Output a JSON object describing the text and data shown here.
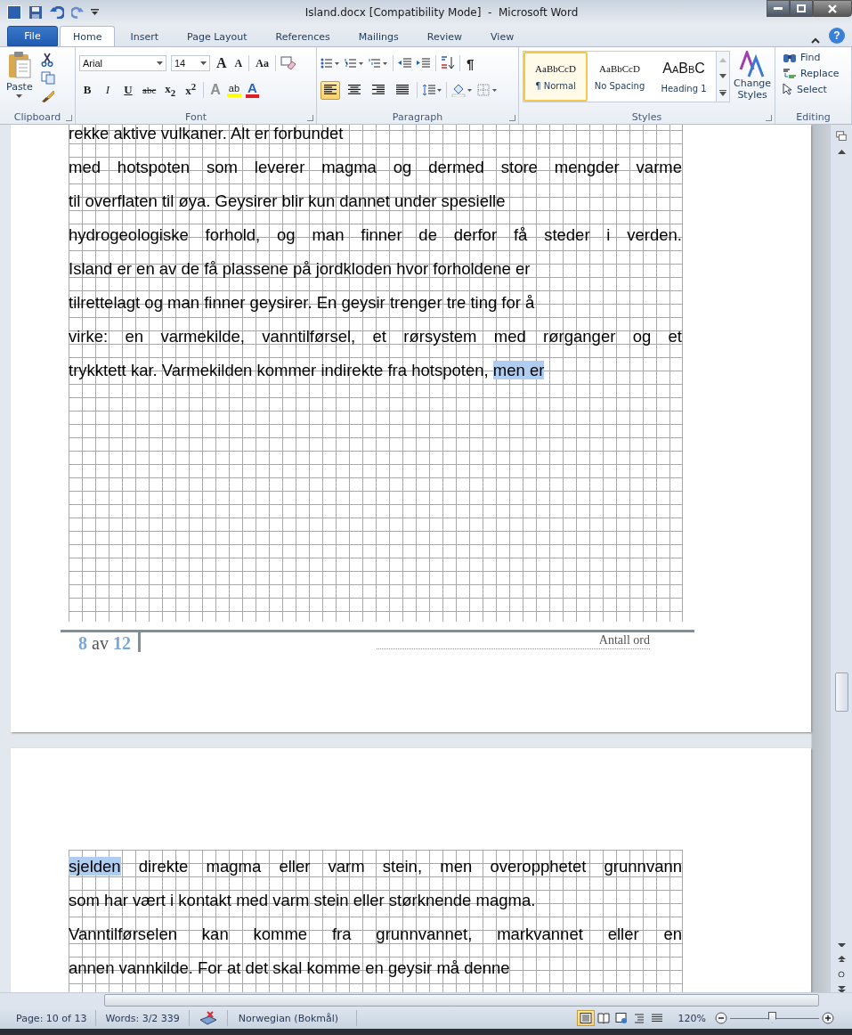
{
  "window": {
    "title": "Island.docx [Compatibility Mode]  -  Microsoft Word"
  },
  "help": "?",
  "tabs": [
    {
      "label": "File",
      "kind": "file",
      "selected": false
    },
    {
      "label": "Home",
      "kind": "tab",
      "selected": true
    },
    {
      "label": "Insert",
      "kind": "tab",
      "selected": false
    },
    {
      "label": "Page Layout",
      "kind": "tab",
      "selected": false
    },
    {
      "label": "References",
      "kind": "tab",
      "selected": false
    },
    {
      "label": "Mailings",
      "kind": "tab",
      "selected": false
    },
    {
      "label": "Review",
      "kind": "tab",
      "selected": false
    },
    {
      "label": "View",
      "kind": "tab",
      "selected": false
    }
  ],
  "clipboard": {
    "paste": "Paste",
    "label": "Clipboard"
  },
  "font": {
    "name": "Arial",
    "size": "14",
    "grow": "A",
    "shrink": "A",
    "change_case": "Aa",
    "format_buttons": [
      "B",
      "I",
      "U",
      "abc",
      "x$_{2}$",
      "x$^{2}$"
    ],
    "effects": "A",
    "highlight": "ab",
    "font_color_letter": "A",
    "label": "Font"
  },
  "paragraph": {
    "pilcrow": "¶",
    "alignment": [
      {
        "kind": "left",
        "selected": true
      },
      {
        "kind": "center",
        "selected": false
      },
      {
        "kind": "right",
        "selected": false
      },
      {
        "kind": "justify",
        "selected": false
      }
    ],
    "label": "Paragraph"
  },
  "styles": {
    "items": [
      {
        "preview": "AaBbCcD",
        "name": "¶ Normal",
        "kind": "body",
        "selected": true
      },
      {
        "preview": "AaBbCcD",
        "name": "No Spacing",
        "kind": "body",
        "selected": false
      },
      {
        "preview": "AaBbC",
        "name": "Heading 1",
        "kind": "heading",
        "selected": false
      }
    ],
    "change": "Change Styles",
    "label": "Styles"
  },
  "editing": {
    "items": [
      {
        "label": "Find",
        "kind": "find"
      },
      {
        "label": "Replace",
        "kind": "replace"
      },
      {
        "label": "Select",
        "kind": "select"
      }
    ],
    "label": "Editing"
  },
  "pages": [
    {
      "lines": [
        {
          "justified": false,
          "segments": [
            {
              "text": "rekke aktive vulkaner. Alt er forbundet",
              "selected": false
            }
          ]
        },
        {
          "justified": true,
          "segments": [
            {
              "text": "med hotspoten som leverer magma og dermed store mengder varme",
              "selected": false
            }
          ]
        },
        {
          "justified": false,
          "segments": [
            {
              "text": "til overflaten til øya. Geysirer blir kun dannet under spesielle",
              "selected": false
            }
          ]
        },
        {
          "justified": true,
          "segments": [
            {
              "text": "hydrogeologiske forhold, og man finner de derfor få steder i verden.",
              "selected": false
            }
          ]
        },
        {
          "justified": false,
          "segments": [
            {
              "text": "Island er en av de få plassene på jordkloden hvor forholdene er",
              "selected": false
            }
          ]
        },
        {
          "justified": false,
          "segments": [
            {
              "text": "tilrettelagt og man finner geysirer. En geysir trenger tre ting for å",
              "selected": false
            }
          ]
        },
        {
          "justified": true,
          "segments": [
            {
              "text": "virke: en varmekilde, vanntilførsel, et rørsystem med rørganger og et",
              "selected": false
            }
          ]
        },
        {
          "justified": false,
          "segments": [
            {
              "text": "trykktett kar. Varmekilden kommer indirekte fra hotspoten, ",
              "selected": false
            },
            {
              "text": "men er",
              "selected": true
            }
          ]
        }
      ],
      "footer": {
        "page": "8",
        "of": "av",
        "total": "12",
        "word_count": "Antall ord"
      }
    },
    {
      "lines": [
        {
          "justified": true,
          "segments": [
            {
              "text": "sjelden",
              "selected": true
            },
            {
              "text": " direkte magma eller varm stein, men overopphetet grunnvann",
              "selected": false
            }
          ]
        },
        {
          "justified": false,
          "segments": [
            {
              "text": "som har vært i kontakt med varm stein eller størknende magma.",
              "selected": false
            }
          ]
        },
        {
          "justified": true,
          "segments": [
            {
              "text": "Vanntilførselen kan komme fra grunnvannet, markvannet eller en",
              "selected": false
            }
          ]
        },
        {
          "justified": false,
          "segments": [
            {
              "text": "annen vannkilde. For at det skal komme en geysir må denne",
              "selected": false
            }
          ]
        }
      ]
    }
  ],
  "status_bar": {
    "page": "Page: 10 of 13",
    "words": "Words: 3/2 339",
    "language": "Norwegian (Bokmål)",
    "views": [
      {
        "kind": "print",
        "selected": true
      },
      {
        "kind": "reading",
        "selected": false
      },
      {
        "kind": "web",
        "selected": false
      },
      {
        "kind": "outline",
        "selected": false
      },
      {
        "kind": "draft",
        "selected": false
      }
    ],
    "zoom": "120%",
    "zoom_slider": {
      "level": 0.48
    }
  }
}
